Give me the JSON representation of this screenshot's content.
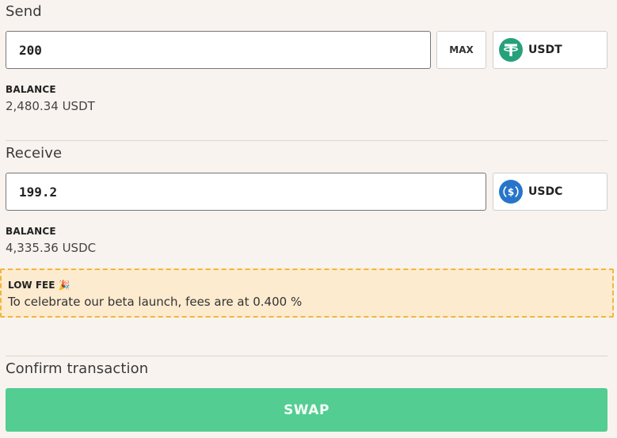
{
  "send": {
    "label": "Send",
    "amount": "200",
    "max_label": "MAX",
    "token": {
      "symbol": "USDT",
      "icon": "tether-icon",
      "color": "#26a17b"
    },
    "balance_label": "BALANCE",
    "balance_value": "2,480.34 USDT"
  },
  "receive": {
    "label": "Receive",
    "amount": "199.2",
    "token": {
      "symbol": "USDC",
      "icon": "usdc-icon",
      "color": "#2775ca"
    },
    "balance_label": "BALANCE",
    "balance_value": "4,335.36 USDC"
  },
  "fee_notice": {
    "title": "LOW FEE 🎉",
    "text": "To celebrate our beta launch, fees are at 0.400 %"
  },
  "confirm": {
    "label": "Confirm transaction",
    "swap_label": "SWAP"
  },
  "colors": {
    "background": "#f8f3ef",
    "swap_button": "#53cd92",
    "banner_bg": "#fdebcf",
    "banner_border": "#f0b73b"
  }
}
